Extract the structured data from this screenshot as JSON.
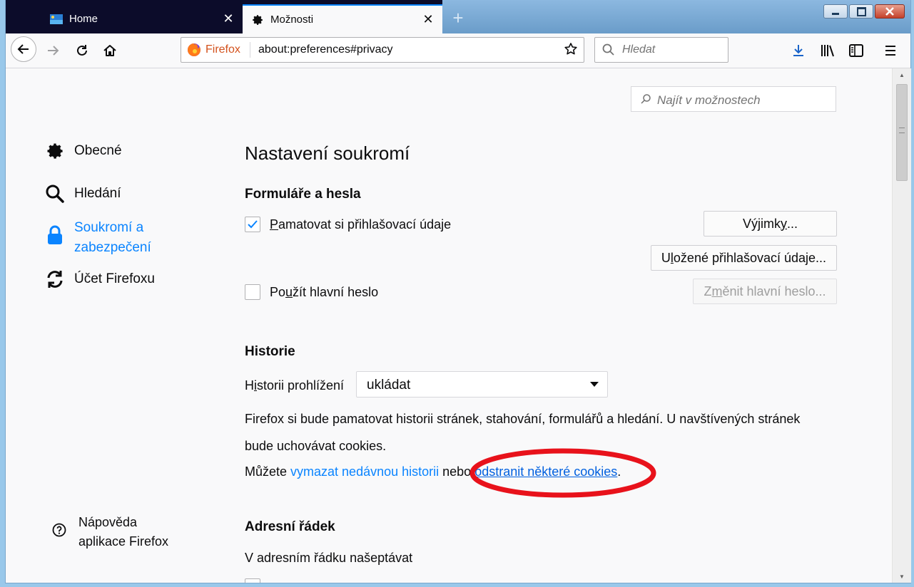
{
  "tabs": [
    {
      "title": "Home",
      "close": "✕"
    },
    {
      "title": "Možnosti",
      "close": "✕"
    }
  ],
  "new_tab_label": "+",
  "urlbar": {
    "identity": "Firefox",
    "url": "about:preferences#privacy"
  },
  "searchbar": {
    "placeholder": "Hledat"
  },
  "find": {
    "placeholder": "Najít v možnostech"
  },
  "sidebar": {
    "items": [
      {
        "label": "Obecné",
        "icon": "gear-icon"
      },
      {
        "label": "Hledání",
        "icon": "search-icon"
      },
      {
        "label_line1": "Soukromí a",
        "label_line2": "zabezpečení",
        "icon": "lock-icon",
        "selected": true
      },
      {
        "label": "Účet Firefoxu",
        "icon": "sync-icon"
      }
    ],
    "help_line1": "Nápověda",
    "help_line2": "aplikace Firefox"
  },
  "page_title": "Nastavení soukromí",
  "forms": {
    "heading": "Formuláře a hesla",
    "remember_pre": "",
    "remember_key": "P",
    "remember_post": "amatovat si přihlašovací údaje",
    "remember_checked": true,
    "exceptions_pre": "Výjimk",
    "exceptions_key": "y",
    "exceptions_post": "...",
    "saved_pre": "U",
    "saved_key": "l",
    "saved_post": "ožené přihlašovací údaje...",
    "master_pre": "Po",
    "master_key": "u",
    "master_post": "žít hlavní heslo",
    "master_checked": false,
    "change_pre": "Z",
    "change_key": "m",
    "change_post": "ěnit hlavní heslo..."
  },
  "history": {
    "heading": "Historie",
    "label_pre": "H",
    "label_key": "i",
    "label_post": "storii prohlížení",
    "mode": "ukládat",
    "description_line1": "Firefox si bude pamatovat historii stránek, stahování, formulářů a hledání. U navštívených stránek",
    "description_line2": "bude uchovávat cookies.",
    "links_prefix": "Můžete ",
    "link_clear": "vymazat nedávnou historii",
    "links_middle": " nebo ",
    "link_cookies": "odstranit některé cookies",
    "links_suffix": "."
  },
  "addressbar": {
    "heading": "Adresní řádek",
    "suggest_label": "V adresním řádku našeptávat"
  },
  "colors": {
    "accent": "#0a84ff",
    "annotation": "#e8121b",
    "tab_strip": "#0c0c2a"
  }
}
